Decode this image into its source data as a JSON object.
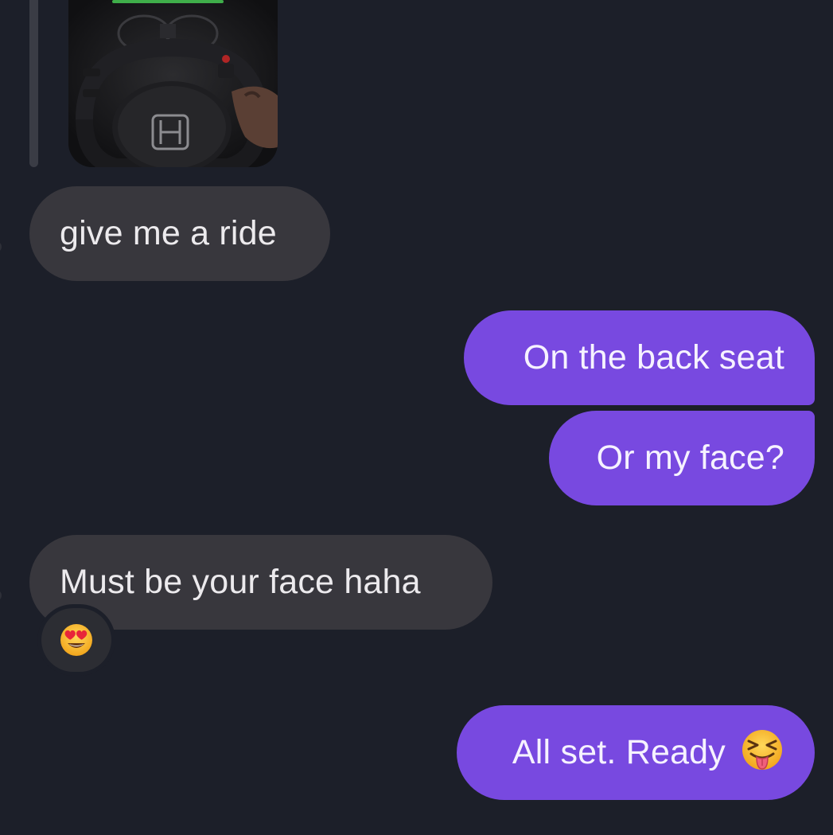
{
  "chat": {
    "messages": [
      {
        "direction": "incoming",
        "text": "give me a ride"
      },
      {
        "direction": "outgoing",
        "text": "On the back seat"
      },
      {
        "direction": "outgoing",
        "text": "Or my face?"
      },
      {
        "direction": "incoming",
        "text": "Must be your face haha",
        "reaction": "smiling-face-with-heart-eyes-icon"
      },
      {
        "direction": "outgoing",
        "text": "All set. Ready",
        "trailing_emoji": "squinting-face-with-tongue-icon"
      }
    ]
  },
  "colors": {
    "background": "#1c1f29",
    "incoming_bubble": "#38373d",
    "outgoing_bubble": "#7849e0",
    "reaction_pill": "#2c2d33"
  }
}
